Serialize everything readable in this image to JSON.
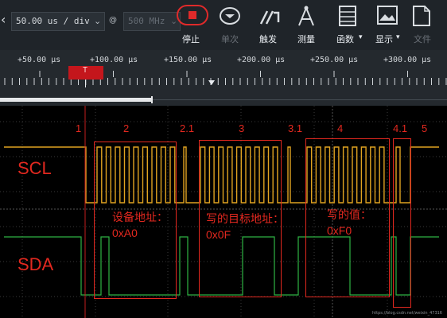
{
  "toolbar": {
    "timebase_value": "50.00 us / div",
    "at_symbol": "@",
    "sample_rate": "500 MHz",
    "buttons": {
      "stop": "停止",
      "single": "单次",
      "trigger": "触发",
      "measure": "测量",
      "function": "函数",
      "display": "显示",
      "file": "文件"
    }
  },
  "ruler": {
    "time_labels": [
      "+50.00 μs",
      "+100.00 μs",
      "+150.00 μs",
      "+200.00 μs",
      "+250.00 μs",
      "+300.00 μs"
    ],
    "trigger_marker": "T"
  },
  "scope": {
    "phase_numbers": [
      "1",
      "2",
      "2.1",
      "3",
      "3.1",
      "4",
      "4.1",
      "5"
    ],
    "channels": {
      "scl": "SCL",
      "sda": "SDA"
    },
    "annotations": {
      "device_address_label": "设备地址：",
      "device_address_value": "0xA0",
      "target_address_label": "写的目标地址：",
      "target_address_value": "0x0F",
      "write_value_label": "写的值：",
      "write_value_value": "0xF0"
    },
    "watermark": "https://blog.csdn.net/weixin_47316",
    "colors": {
      "scl_trace": "#e0a321",
      "sda_trace": "#2fb343",
      "annotation": "#e2281f"
    }
  }
}
